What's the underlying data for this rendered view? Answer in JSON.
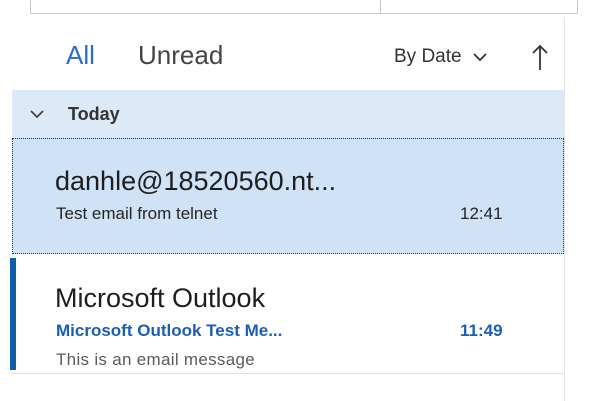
{
  "filter": {
    "tabs": [
      {
        "label": "All",
        "active": true
      },
      {
        "label": "Unread",
        "active": false
      }
    ],
    "sort_label": "By Date",
    "sort_chevron_icon": "chevron-down-icon",
    "sort_direction_icon": "arrow-up-icon"
  },
  "group": {
    "title": "Today",
    "icon": "chevron-down-icon"
  },
  "messages": [
    {
      "sender": "danhle@18520560.nt...",
      "subject": "Test email from telnet",
      "time": "12:41",
      "preview": "",
      "selected": true,
      "unread": false
    },
    {
      "sender": "Microsoft Outlook",
      "subject": "Microsoft Outlook Test Me...",
      "time": "11:49",
      "preview": "This is an email message",
      "selected": false,
      "unread": true
    }
  ],
  "colors": {
    "accent": "#2b6cc4",
    "selected_bg": "#cfe2f6",
    "group_bg": "#dce9f7",
    "unread_bar": "#0f5fa8",
    "unread_text": "#1a5fb4"
  }
}
